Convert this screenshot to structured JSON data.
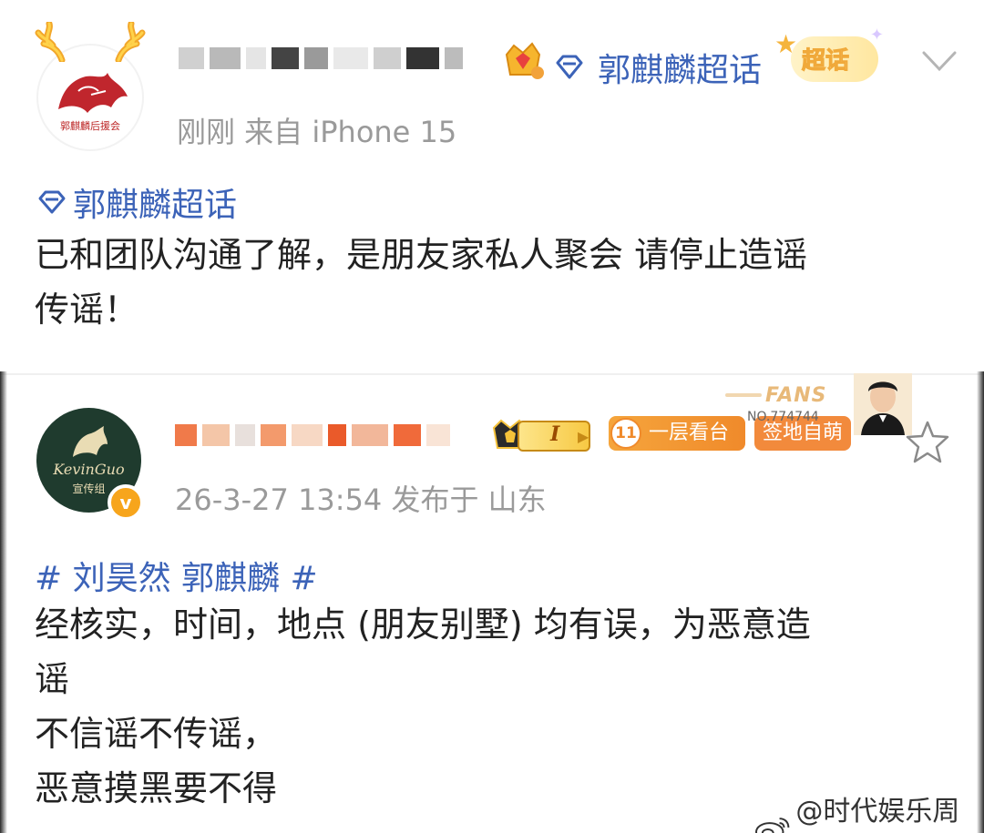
{
  "post1": {
    "name_blurred": true,
    "chat_tag": "郭麒麟超话",
    "super_label": "超话",
    "meta": "刚刚  来自 iPhone 15",
    "topic": "郭麒麟超话",
    "body_lines": [
      "已和团队沟通了解，是朋友家私人聚会 请停止造谣",
      "传谣！"
    ],
    "avatar_text": "郭麒麟后援会"
  },
  "post2": {
    "name_blurred": true,
    "level": "I",
    "stand_level": "11",
    "stand_label": "一层看台",
    "sign_label": "签地自萌",
    "fans_label": "FANS",
    "fans_no": "NO.774744",
    "meta": "26-3-27 13:54  发布于 山东",
    "topic": "# 刘昊然 郭麒麟 #",
    "body_lines": [
      "经核实，时间，地点 (朋友别墅) 均有误，为恶意造",
      "谣",
      "不信谣不传谣，",
      "恶意摸黑要不得"
    ],
    "avatar_brand": "KevinGuo",
    "avatar_sub": "宣传组",
    "verified_mark": "v"
  },
  "watermark": "@时代娱乐周刊",
  "colors": {
    "link_blue": "#3c63b8",
    "meta_gray": "#9a9a9a",
    "orange": "#f08a2b",
    "gold": "#f7c944"
  }
}
